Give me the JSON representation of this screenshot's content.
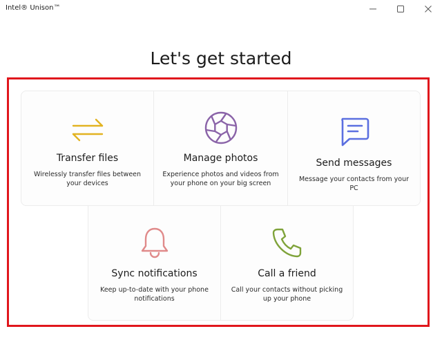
{
  "window": {
    "title": "Intel® Unison™",
    "controls": {
      "minimize_icon": "minimize-icon",
      "maximize_icon": "maximize-icon",
      "close_icon": "close-icon"
    }
  },
  "page": {
    "title": "Let's get started"
  },
  "cards": {
    "transfer": {
      "title": "Transfer files",
      "description": "Wirelessly transfer files between your devices",
      "icon": "transfer-arrows-icon",
      "color": "#e2b321"
    },
    "photos": {
      "title": "Manage photos",
      "description": "Experience photos and videos from your phone on your big screen",
      "icon": "camera-aperture-icon",
      "color": "#8a63a8"
    },
    "messages": {
      "title": "Send messages",
      "description": "Message your contacts from your PC",
      "icon": "chat-bubble-icon",
      "color": "#5b6fe0"
    },
    "notifications": {
      "title": "Sync notifications",
      "description": "Keep up-to-date with your phone notifications",
      "icon": "bell-icon",
      "color": "#e08a8a"
    },
    "call": {
      "title": "Call a friend",
      "description": "Call your contacts without picking up your phone",
      "icon": "phone-icon",
      "color": "#7fa33a"
    }
  },
  "highlight_color": "#e0161c"
}
